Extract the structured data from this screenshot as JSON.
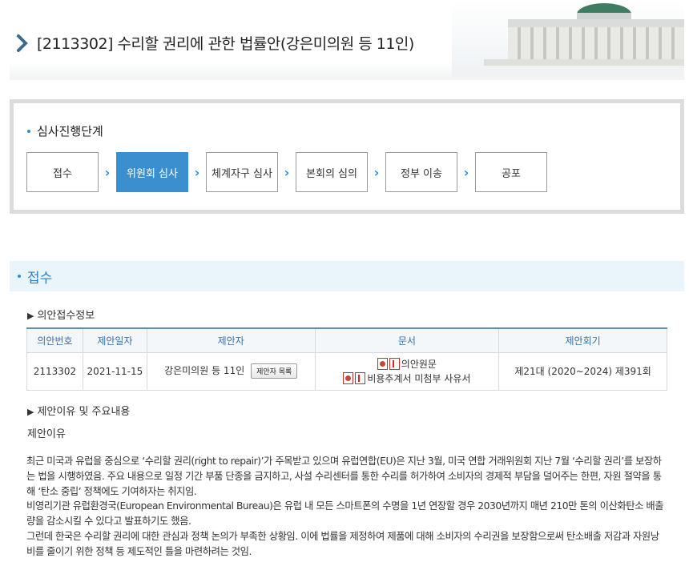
{
  "header": {
    "title": "[2113302] 수리할 권리에 관한 법률안(강은미의원 등 11인)"
  },
  "stage": {
    "title": "심사진행단계",
    "steps": [
      "접수",
      "위원회 심사",
      "체계자구 심사",
      "본회의 심의",
      "정부 이송",
      "공포"
    ],
    "active_index": 1
  },
  "section": {
    "title": "접수",
    "receipt_info_label": "의안접수정보",
    "reason_header": "제안이유 및 주요내용",
    "reason_label": "제안이유"
  },
  "table": {
    "headers": [
      "의안번호",
      "제안일자",
      "제안자",
      "문서",
      "제안회기"
    ],
    "row": {
      "bill_no": "2113302",
      "date": "2021-11-15",
      "proposer": "강은미의원 등 11인",
      "proposer_button": "제안자 목록",
      "doc1": "의안원문",
      "doc2": "비용추계서 미첨부 사유서",
      "session": "제21대 (2020~2024) 제391회"
    }
  },
  "body": {
    "p1": "최근 미국과 유럽을 중심으로 ‘수리할 권리(right to repair)’가 주목받고 있으며 유럽연합(EU)은 지난 3월, 미국 연합 거래위원회 지난 7월 ‘수리할 권리’를 보장하는 법을 시행하였음. 주요 내용으로 일정 기간 부품 단종을 금지하고, 사설 수리센터를 통한 수리를 허가하여 소비자의 경제적 부담을 덜어주는 한편, 자원 절약을 통해 ‘탄소 중립’ 정책에도 기여하자는 취지임.",
    "p2": "비영리기관 유럽환경국(European Environmental Bureau)은 유럽 내 모든 스마트폰의 수명을 1년 연장할 경우 2030년까지 매년 210만 톤의 이산화탄소 배출량을 감소시킬 수 있다고 발표하기도 했음.",
    "p3": "그런데 한국은 수리할 권리에 대한 관심과 정책 논의가 부족한 상황임. 이에 법률을 제정하여 제품에 대해 소비자의 수리권을 보장함으로써 탄소배출 저감과 자원낭비를 줄이기 위한 정책 등 제도적인 틀을 마련하려는 것임."
  }
}
